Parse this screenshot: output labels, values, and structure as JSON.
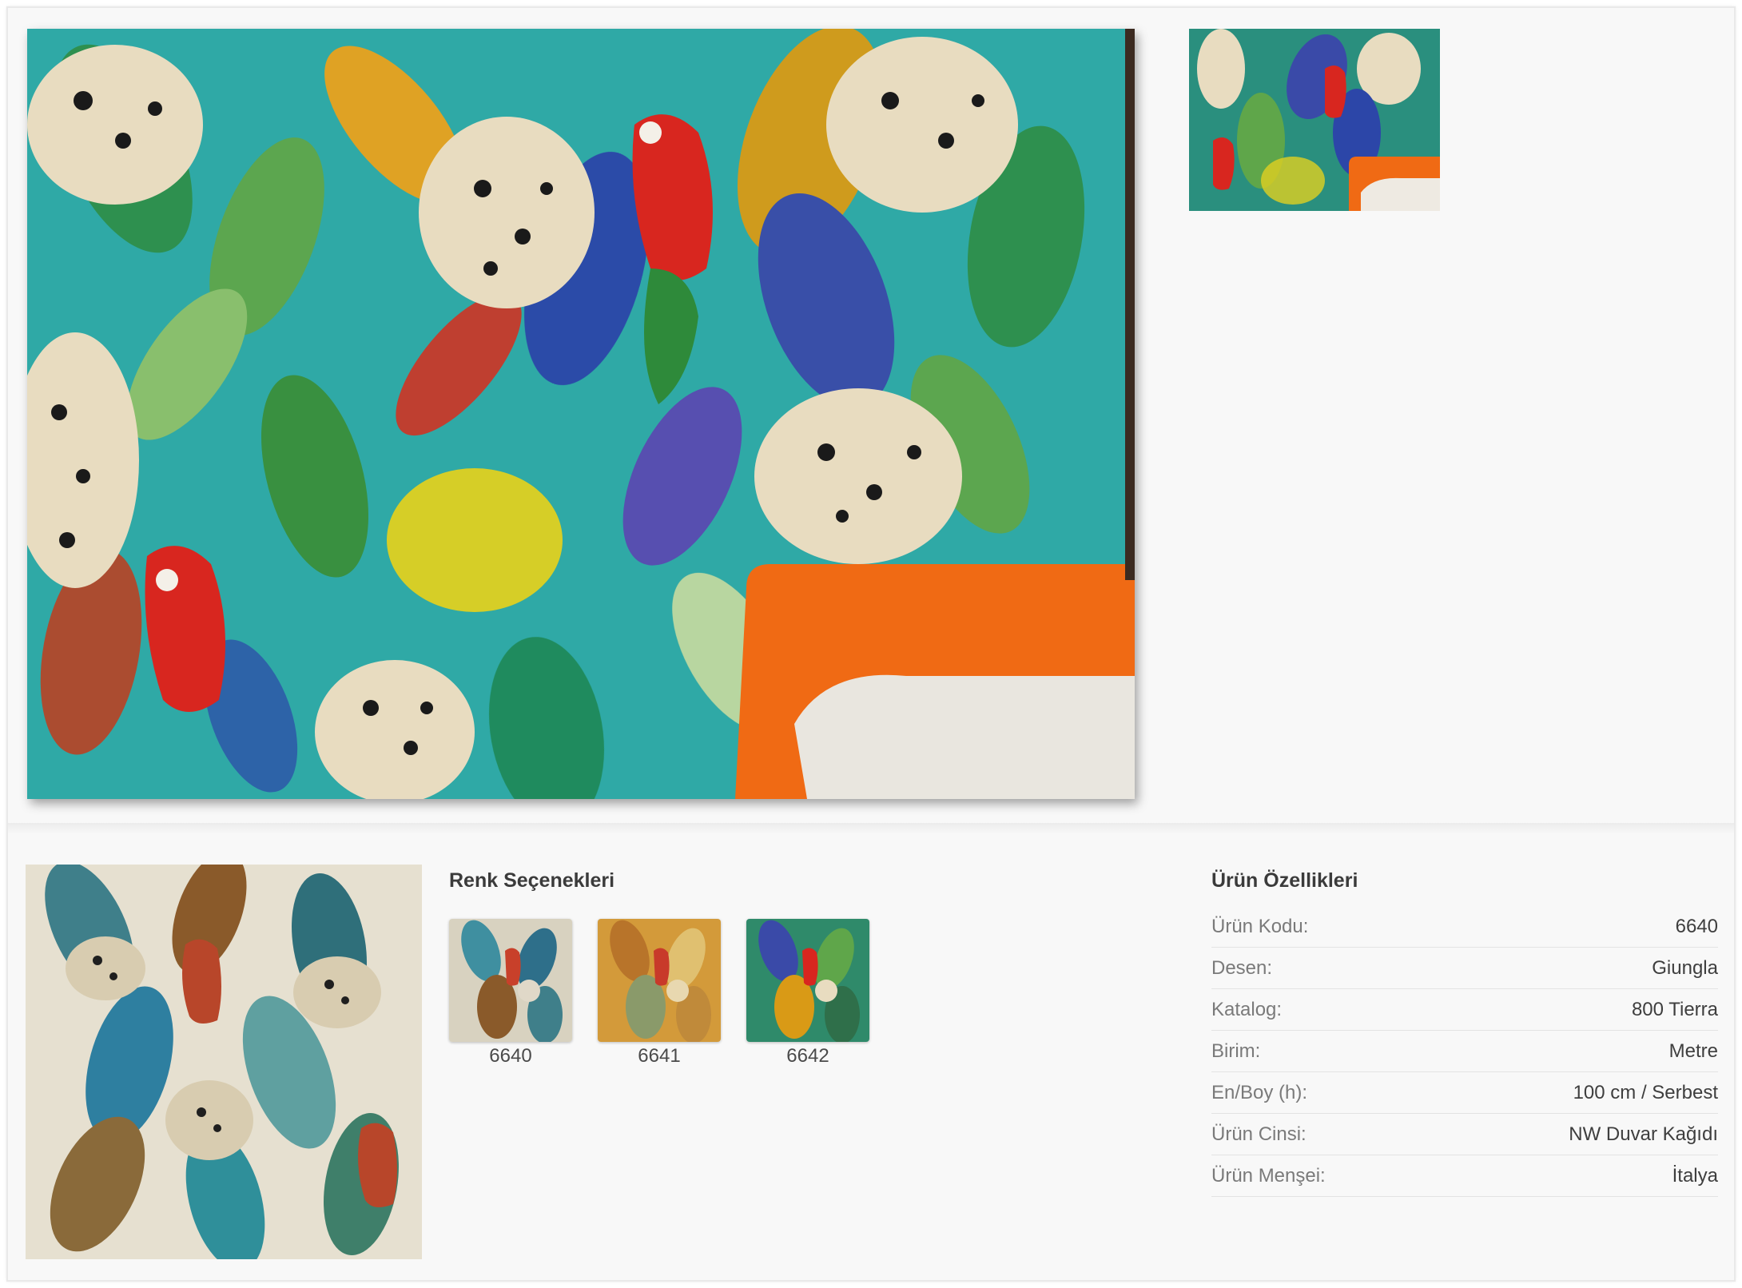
{
  "product": {
    "main_image_alt": "Giungla 6640",
    "thumbnail_alt": "Giungla 6640"
  },
  "colors": {
    "heading": "Renk Seçenekleri",
    "swatches": [
      {
        "code": "6640"
      },
      {
        "code": "6641"
      },
      {
        "code": "6642"
      }
    ]
  },
  "specs": {
    "heading": "Ürün Özellikleri",
    "rows": [
      {
        "label": "Ürün Kodu:",
        "value": "6640"
      },
      {
        "label": "Desen:",
        "value": "Giungla"
      },
      {
        "label": "Katalog:",
        "value": "800 Tierra"
      },
      {
        "label": "Birim:",
        "value": "Metre"
      },
      {
        "label": "En/Boy (h):",
        "value": "100 cm / Serbest"
      },
      {
        "label": "Ürün Cinsi:",
        "value": "NW Duvar Kağıdı"
      },
      {
        "label": "Ürün Menşei:",
        "value": "İtalya"
      }
    ]
  },
  "theme": {
    "background": "#f8f8f8",
    "wallpaper_teal": "#2fa9a6",
    "sofa_orange": "#f06a14",
    "parrot_red": "#d8261f",
    "leopard_cream": "#e8dcc0"
  }
}
